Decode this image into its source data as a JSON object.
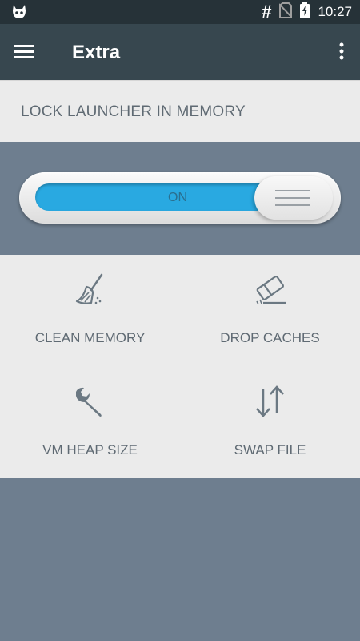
{
  "status_bar": {
    "hash": "#",
    "time": "10:27",
    "icons": [
      "cyanogen-icon",
      "no-sim-icon",
      "battery-charging-icon"
    ]
  },
  "app_bar": {
    "title": "Extra",
    "icons": [
      "menu-icon",
      "more-vert-icon"
    ]
  },
  "section": {
    "label": "LOCK LAUNCHER IN MEMORY"
  },
  "toggle": {
    "state_label": "ON",
    "on": true,
    "accent_color": "#29a9e1"
  },
  "tools": [
    {
      "label": "CLEAN MEMORY",
      "icon": "broom-icon"
    },
    {
      "label": "DROP CACHES",
      "icon": "eraser-icon"
    },
    {
      "label": "VM HEAP SIZE",
      "icon": "wrench-icon"
    },
    {
      "label": "SWAP FILE",
      "icon": "swap-vert-icon"
    }
  ],
  "colors": {
    "status_bar": "#263238",
    "app_bar": "#37474f",
    "panel": "#ebebeb",
    "background": "#6e7e8f",
    "text": "#5f6a73"
  }
}
